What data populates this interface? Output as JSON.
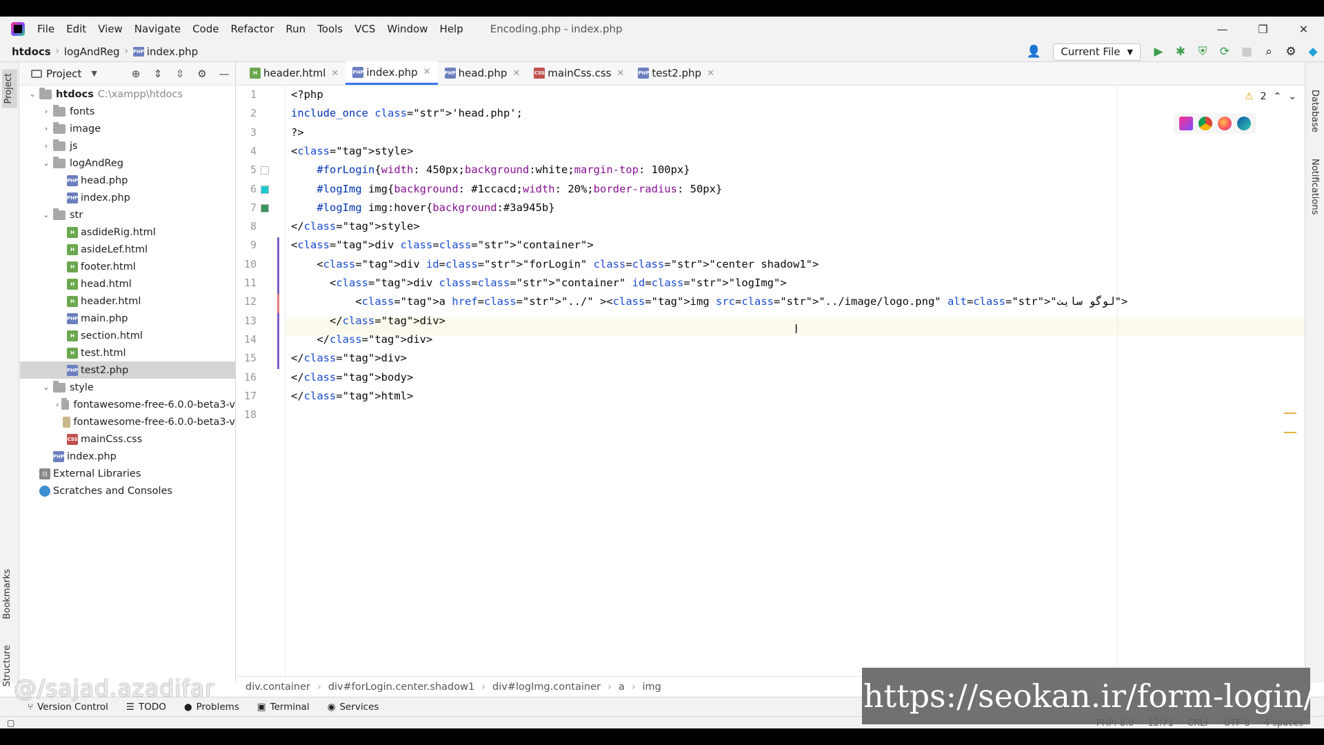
{
  "app": {
    "window_title": "Encoding.php - index.php"
  },
  "menu": [
    "File",
    "Edit",
    "View",
    "Navigate",
    "Code",
    "Refactor",
    "Run",
    "Tools",
    "VCS",
    "Window",
    "Help"
  ],
  "window_controls": {
    "minimize": "—",
    "restore": "❐",
    "close": "✕"
  },
  "breadcrumb": {
    "root": "htdocs",
    "folder": "logAndReg",
    "file": "index.php"
  },
  "toolbar": {
    "run_config": "Current File"
  },
  "left_strip": {
    "project": "Project",
    "bookmarks": "Bookmarks",
    "structure": "Structure"
  },
  "right_strip": {
    "database": "Database",
    "notifications": "Notifications"
  },
  "project_panel": {
    "title": "Project",
    "tree": [
      {
        "label": "htdocs",
        "hint": "C:\\xampp\\htdocs",
        "type": "folder",
        "arrow": "⌄",
        "depth": 0
      },
      {
        "label": "fonts",
        "type": "folder",
        "arrow": "›",
        "depth": 1
      },
      {
        "label": "image",
        "type": "folder",
        "arrow": "›",
        "depth": 1
      },
      {
        "label": "js",
        "type": "folder",
        "arrow": "›",
        "depth": 1
      },
      {
        "label": "logAndReg",
        "type": "folder",
        "arrow": "⌄",
        "depth": 1
      },
      {
        "label": "head.php",
        "type": "php",
        "depth": 2
      },
      {
        "label": "index.php",
        "type": "php",
        "depth": 2
      },
      {
        "label": "str",
        "type": "folder",
        "arrow": "⌄",
        "depth": 1
      },
      {
        "label": "asdideRig.html",
        "type": "html",
        "depth": 2
      },
      {
        "label": "asideLef.html",
        "type": "html",
        "depth": 2
      },
      {
        "label": "footer.html",
        "type": "html",
        "depth": 2
      },
      {
        "label": "head.html",
        "type": "html",
        "depth": 2
      },
      {
        "label": "header.html",
        "type": "html",
        "depth": 2
      },
      {
        "label": "main.php",
        "type": "php",
        "depth": 2
      },
      {
        "label": "section.html",
        "type": "html",
        "depth": 2
      },
      {
        "label": "test.html",
        "type": "html",
        "depth": 2
      },
      {
        "label": "test2.php",
        "type": "php",
        "depth": 2,
        "selected": true
      },
      {
        "label": "style",
        "type": "folder",
        "arrow": "⌄",
        "depth": 1
      },
      {
        "label": "fontawesome-free-6.0.0-beta3-v",
        "type": "folder",
        "arrow": "›",
        "depth": 2
      },
      {
        "label": "fontawesome-free-6.0.0-beta3-v",
        "type": "zip",
        "depth": 2
      },
      {
        "label": "mainCss.css",
        "type": "css",
        "depth": 2
      },
      {
        "label": "index.php",
        "type": "php",
        "depth": 1
      },
      {
        "label": "External Libraries",
        "type": "lib",
        "depth": 0
      },
      {
        "label": "Scratches and Consoles",
        "type": "scratch",
        "depth": 0
      }
    ]
  },
  "tabs": [
    {
      "label": "header.html",
      "type": "html",
      "active": false
    },
    {
      "label": "index.php",
      "type": "php",
      "active": true
    },
    {
      "label": "head.php",
      "type": "php",
      "active": false
    },
    {
      "label": "mainCss.css",
      "type": "css",
      "active": false
    },
    {
      "label": "test2.php",
      "type": "php",
      "active": false
    }
  ],
  "inspection": {
    "warnings": "2"
  },
  "colors": {
    "swatch_line6": "#1ccacd",
    "swatch_line7": "#3a945b",
    "accent": "#3574f0"
  },
  "code_lines": [
    "<?php",
    "include_once 'head.php';",
    "?>",
    "<style>",
    "    #forLogin{width: 450px;background:white;margin-top: 100px}",
    "    #logImg img{background: #1ccacd;width: 20%;border-radius: 50px}",
    "    #logImg img:hover{background:#3a945b}",
    "</style>",
    "<div class=\"container\">",
    "    <div id=\"forLogin\" class=\"center shadow1\">",
    "      <div class=\"container\" id=\"logImg\">",
    "          <a href=\"../\" ><img src=\"../image/logo.png\" alt=\"لوگو سایت\">",
    "      </div>",
    "    </div>",
    "</div>",
    "</body>",
    "</html>",
    ""
  ],
  "code_crumbs": [
    "div.container",
    "div#forLogin.center.shadow1",
    "div#logImg.container",
    "a",
    "img"
  ],
  "bottom_tools": [
    "Version Control",
    "TODO",
    "Problems",
    "Terminal",
    "Services"
  ],
  "status": {
    "lang": "PHP: 8.0",
    "position": "12:71",
    "line_sep": "CRLF",
    "encoding": "UTF-8",
    "indent": "4 spaces"
  },
  "overlay": {
    "watermark": "@/sajad.azadifar",
    "url": "https://seokan.ir/form-login/"
  }
}
